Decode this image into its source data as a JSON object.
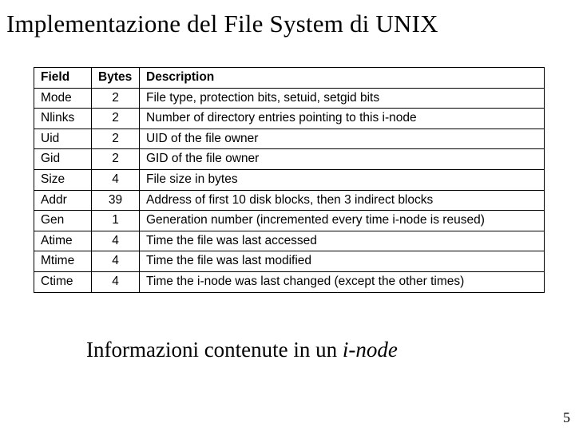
{
  "title": "Implementazione del File System di UNIX",
  "headers": {
    "field": "Field",
    "bytes": "Bytes",
    "desc": "Description"
  },
  "rows": [
    {
      "field": "Mode",
      "bytes": "2",
      "desc": "File type, protection bits, setuid, setgid bits"
    },
    {
      "field": "Nlinks",
      "bytes": "2",
      "desc": "Number of directory entries pointing to this i-node"
    },
    {
      "field": "Uid",
      "bytes": "2",
      "desc": "UID of the file owner"
    },
    {
      "field": "Gid",
      "bytes": "2",
      "desc": "GID of the file owner"
    },
    {
      "field": "Size",
      "bytes": "4",
      "desc": "File size in bytes"
    },
    {
      "field": "Addr",
      "bytes": "39",
      "desc": "Address of first 10 disk blocks, then 3 indirect blocks"
    },
    {
      "field": "Gen",
      "bytes": "1",
      "desc": "Generation number (incremented every time i-node is reused)"
    },
    {
      "field": "Atime",
      "bytes": "4",
      "desc": "Time the file was last accessed"
    },
    {
      "field": "Mtime",
      "bytes": "4",
      "desc": "Time the file was last modified"
    },
    {
      "field": "Ctime",
      "bytes": "4",
      "desc": "Time the i-node was last changed (except the other times)"
    }
  ],
  "caption_prefix": "Informazioni contenute in un ",
  "caption_ital": "i-node",
  "page_number": "5"
}
